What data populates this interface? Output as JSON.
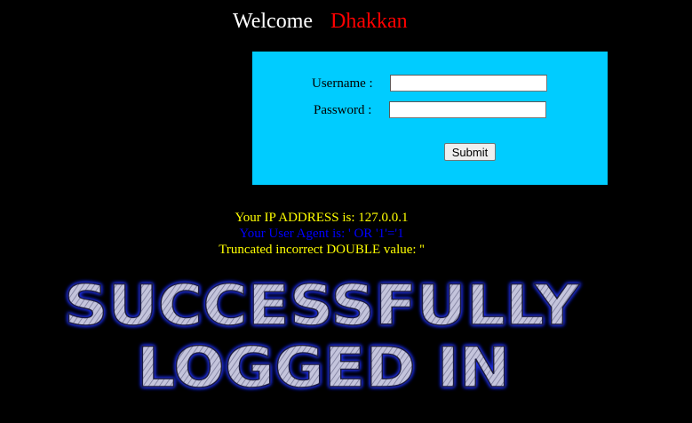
{
  "header": {
    "welcome_label": "Welcome",
    "user_name": "Dhakkan"
  },
  "login_form": {
    "username_label": "Username :",
    "password_label": "Password :",
    "username_value": "",
    "password_value": "",
    "submit_label": "Submit",
    "background_color": "#00ccff"
  },
  "info": {
    "ip_line": "Your IP ADDRESS is: 127.0.0.1",
    "user_agent_line": "Your User Agent is: ' OR '1'='1",
    "error_line": "Truncated incorrect DOUBLE value: ''"
  },
  "banner": {
    "line1": "SUCCESSFULLY",
    "line2": "LOGGED IN",
    "fill_color": "#b8b8d8",
    "glow_color": "#2233ff"
  },
  "colors": {
    "page_background": "#000000",
    "welcome_text": "#ffffff",
    "user_name_text": "#ff0000",
    "ip_text": "#ffff00",
    "user_agent_text": "#0000ff",
    "error_text": "#ffff00"
  }
}
